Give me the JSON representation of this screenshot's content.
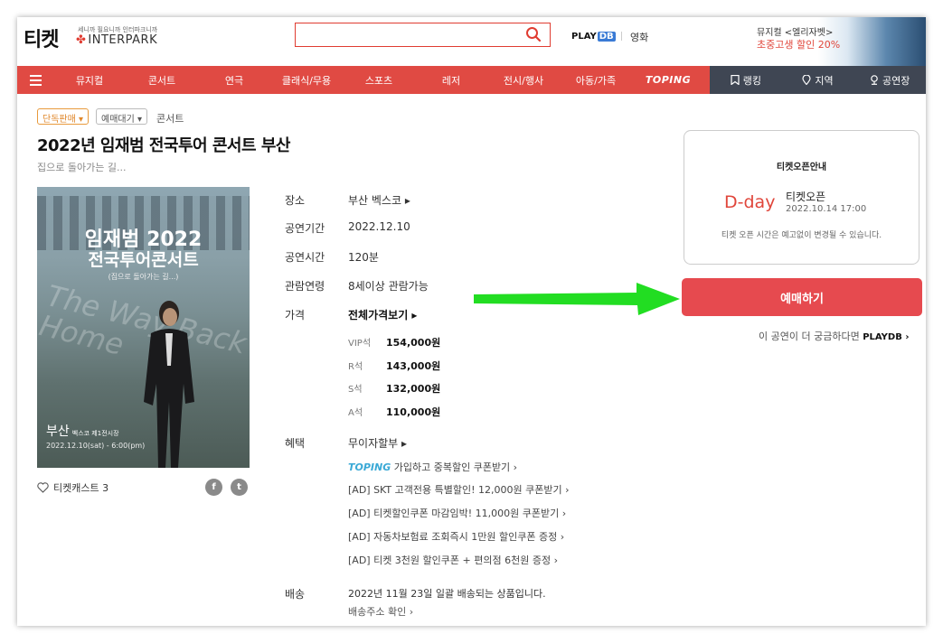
{
  "header": {
    "logo_ticket": "티켓",
    "logo_sub": "세니까 필요니까 인터파크니까",
    "logo_interpark": "INTERPARK",
    "search_placeholder": "",
    "playdb_logo": "PLAY",
    "playdb_db": "DB",
    "movie_label": "영화",
    "promo_line1": "뮤지컬 <엘리자벳>",
    "promo_line2": "초중고생 할인 20%"
  },
  "nav": {
    "items": [
      "뮤지컬",
      "콘서트",
      "연극",
      "클래식/무용",
      "스포츠",
      "레저",
      "전시/행사",
      "아동/가족",
      "TOPING"
    ],
    "right_items": [
      "랭킹",
      "지역",
      "공연장"
    ],
    "accent_color": "#e04a43",
    "dark_color": "#3f4653"
  },
  "product": {
    "badge_exclusive": "단독판매 ▾",
    "badge_presale": "예매대기 ▾",
    "category": "콘서트",
    "title": "2022년 임재범 전국투어 콘서트 부산",
    "subtitle": "집으로 돌아가는 길...",
    "poster": {
      "title1": "임재범 2022",
      "title2": "전국투어콘서트",
      "sub": "(집으로 돌아가는 길...)",
      "way_text": "The Way Back Home",
      "city": "부산",
      "venue": "벡스코 제1전시장",
      "date": "2022.12.10(sat) - 6:00(pm)"
    },
    "cast_label": "티켓캐스트 3",
    "share_fb": "f",
    "share_tw": "t"
  },
  "info": {
    "venue_label": "장소",
    "venue_value": "부산 벡스코 ▸",
    "period_label": "공연기간",
    "period_value": "2022.12.10",
    "runtime_label": "공연시간",
    "runtime_value": "120분",
    "age_label": "관람연령",
    "age_value": "8세이상 관람가능",
    "price_label": "가격",
    "price_all": "전체가격보기 ▸",
    "prices": [
      {
        "grade": "VIP석",
        "amount": "154,000원"
      },
      {
        "grade": "R석",
        "amount": "143,000원"
      },
      {
        "grade": "S석",
        "amount": "132,000원"
      },
      {
        "grade": "A석",
        "amount": "110,000원"
      }
    ],
    "benefit_label": "혜택",
    "benefit_value": "무이자할부 ▸",
    "benefits_toping": "TOPING",
    "benefits": [
      "가입하고 중복할인 쿠폰받기 ›",
      "[AD] SKT 고객전용 특별할인! 12,000원 쿠폰받기 ›",
      "[AD] 티켓할인쿠폰 마감임박! 11,000원 쿠폰받기 ›",
      "[AD] 자동차보험료 조회즉시 1만원 할인쿠폰 증정 ›",
      "[AD] 티켓 3천원 할인쿠폰 + 편의점 6천원 증정 ›"
    ],
    "shipping_label": "배송",
    "shipping_value": "2022년 11월 23일 일괄 배송되는 상품입니다.",
    "shipping_link": "배송주소 확인 ›"
  },
  "open_box": {
    "title": "티켓오픈안내",
    "dday": "D-day",
    "open_label": "티켓오픈",
    "open_date": "2022.10.14 17:00",
    "note": "티켓 오픈 시간은 예고없이 변경될 수 있습니다."
  },
  "booking": {
    "button_label": "예매하기",
    "curious_text": "이 공연이 더 궁금하다면",
    "playdb": "PLAYDB ›",
    "button_color": "#e64a4f"
  },
  "annotation": {
    "arrow_color": "#22dd22"
  }
}
